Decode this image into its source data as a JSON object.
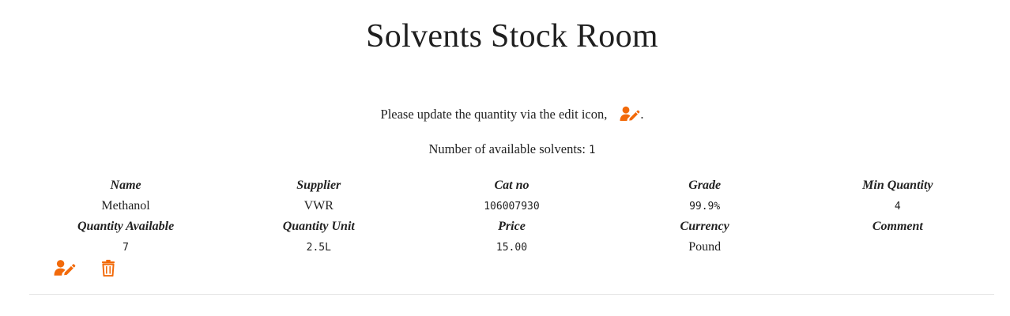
{
  "page": {
    "title": "Solvents Stock Room",
    "instruction": "Please update the quantity via the edit icon,",
    "instruction_end": ".",
    "count_label": "Number of available solvents: ",
    "count_value": "1"
  },
  "colors": {
    "accent": "#f26a0a",
    "text": "#222222",
    "divider": "#e3e3e3"
  },
  "icons": {
    "edit": "user-edit-icon",
    "delete": "trash-icon"
  },
  "table": {
    "header_row_1": [
      "Name",
      "Supplier",
      "Cat no",
      "Grade",
      "Min Quantity"
    ],
    "values_row_1": [
      "Methanol",
      "VWR",
      "106007930",
      "99.9%",
      "4"
    ],
    "header_row_2": [
      "Quantity Available",
      "Quantity Unit",
      "Price",
      "Currency",
      "Comment"
    ],
    "values_row_2": [
      "7",
      "2.5L",
      "15.00",
      "Pound",
      ""
    ]
  }
}
